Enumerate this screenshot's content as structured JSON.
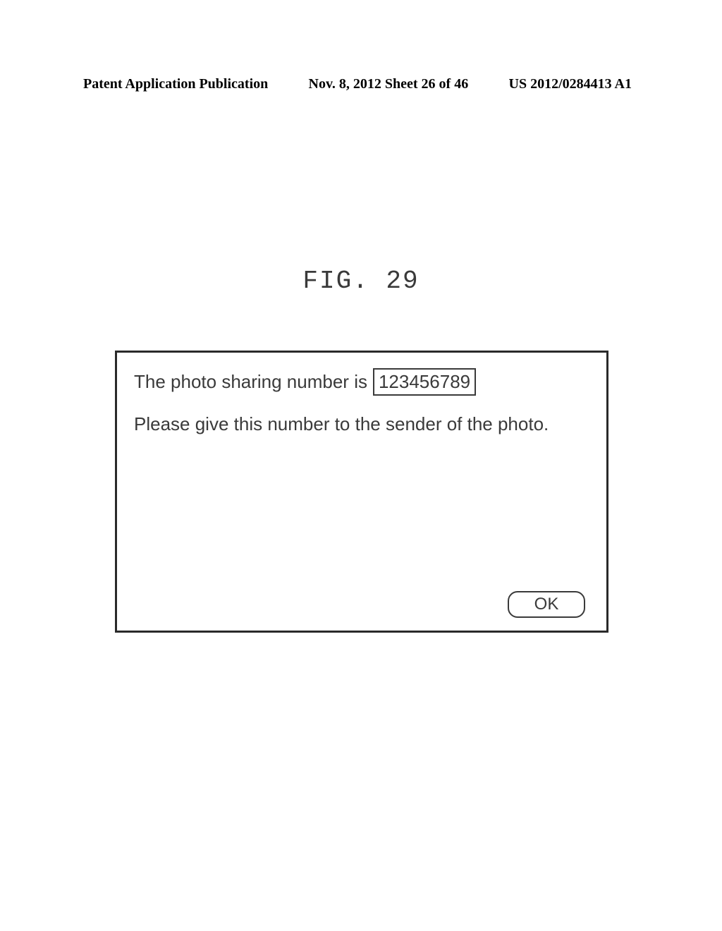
{
  "header": {
    "left": "Patent Application Publication",
    "center": "Nov. 8, 2012  Sheet 26 of 46",
    "right": "US 2012/0284413 A1"
  },
  "figure_label": "FIG. 29",
  "dialog": {
    "line1_prefix": "The photo sharing number is",
    "sharing_number": "123456789",
    "line2": "Please give this number to the sender of the photo.",
    "ok_label": "OK"
  }
}
